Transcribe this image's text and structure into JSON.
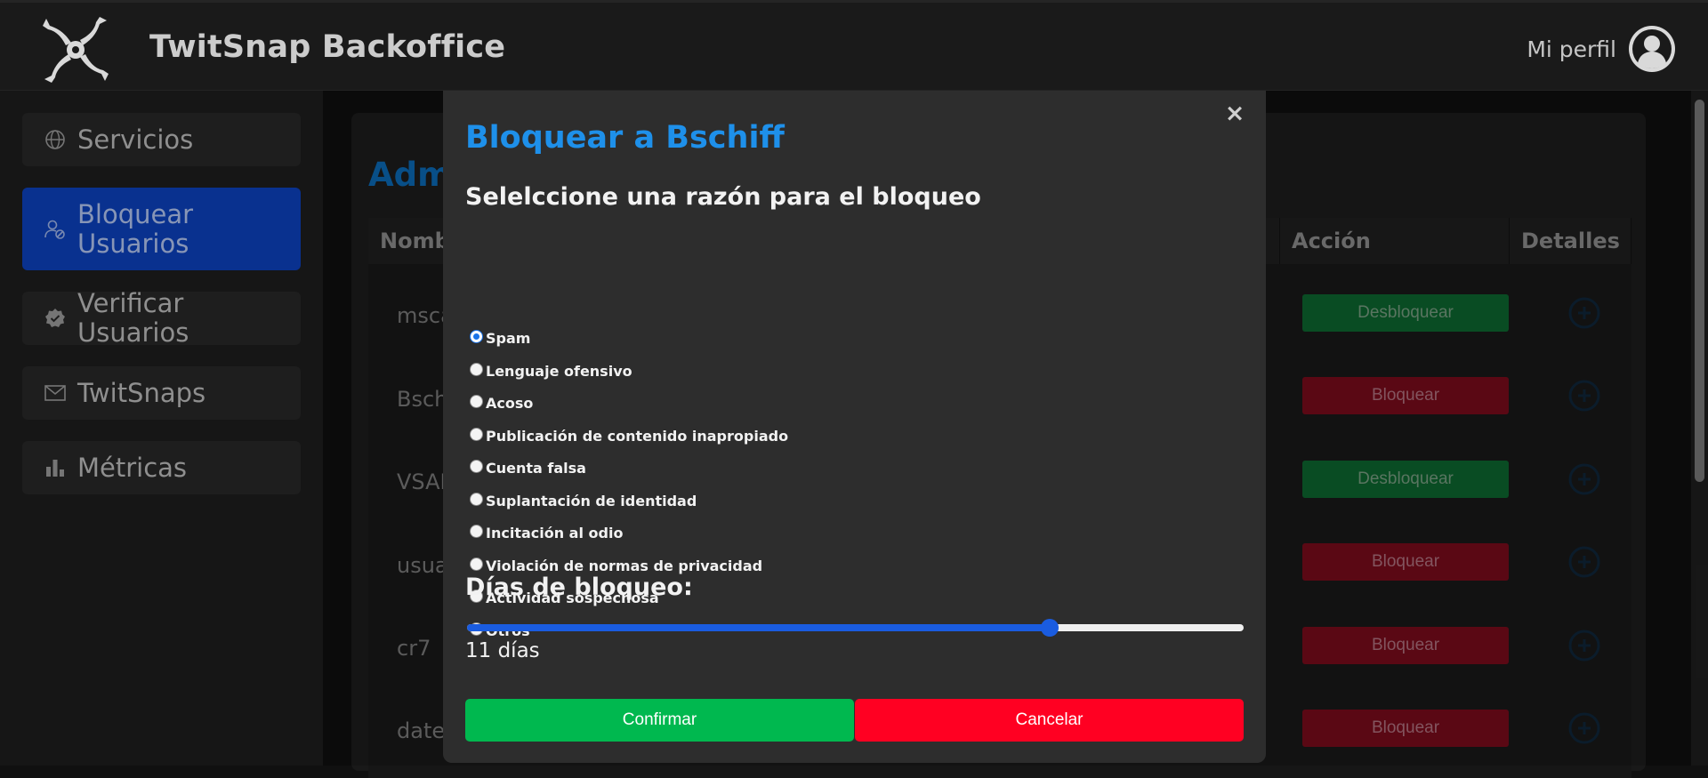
{
  "header": {
    "title": "TwitSnap Backoffice",
    "profile_label": "Mi perfil",
    "logo_icon": "pinwheel-logo-icon",
    "avatar_icon": "user-circle-icon"
  },
  "sidebar": {
    "items": [
      {
        "label": "Servicios",
        "icon": "globe-icon",
        "active": false
      },
      {
        "label": "Bloquear Usuarios",
        "icon": "user-block-icon",
        "active": true
      },
      {
        "label": "Verificar Usuarios",
        "icon": "verified-badge-icon",
        "active": false
      },
      {
        "label": "TwitSnaps",
        "icon": "envelope-icon",
        "active": false
      },
      {
        "label": "Métricas",
        "icon": "bar-chart-icon",
        "active": false
      }
    ]
  },
  "main": {
    "title_visible": "Admi",
    "table": {
      "columns": {
        "name_visible": "Nomb",
        "action": "Acción",
        "details": "Detalles"
      },
      "rows": [
        {
          "user_visible": "mscazz",
          "action": "Desbloquear",
          "action_type": "unblock"
        },
        {
          "user_visible": "Bschiff",
          "action": "Bloquear",
          "action_type": "block"
        },
        {
          "user_visible": "VSANT",
          "action": "Desbloquear",
          "action_type": "unblock"
        },
        {
          "user_visible": "usuario",
          "action": "Bloquear",
          "action_type": "block"
        },
        {
          "user_visible": "cr7",
          "action": "Bloquear",
          "action_type": "block"
        },
        {
          "user_visible": "datepi",
          "action": "Bloquear",
          "action_type": "block"
        }
      ]
    }
  },
  "modal": {
    "title": "Bloquear a Bschiff",
    "subtitle": "Selelccione una razón para el bloqueo",
    "close_label": "×",
    "reasons": [
      {
        "label": "Spam",
        "checked": true
      },
      {
        "label": "Lenguaje ofensivo",
        "checked": false
      },
      {
        "label": "Acoso",
        "checked": false
      },
      {
        "label": "Publicación de contenido inapropiado",
        "checked": false
      },
      {
        "label": "Cuenta falsa",
        "checked": false
      },
      {
        "label": "Suplantación de identidad",
        "checked": false
      },
      {
        "label": "Incitación al odio",
        "checked": false
      },
      {
        "label": "Violación de normas de privacidad",
        "checked": false
      },
      {
        "label": "Actividad sospechosa",
        "checked": false
      },
      {
        "label": "Otros",
        "checked": false
      }
    ],
    "days_title": "Días de bloqueo:",
    "days_value": "11 días",
    "slider_level": 0.75,
    "confirm_label": "Confirmar",
    "cancel_label": "Cancelar"
  },
  "colors": {
    "accent_blue": "#1e90ea",
    "confirm_green": "#00b84f",
    "cancel_red": "#ff0022",
    "active_sidebar": "#0b3aa8"
  }
}
